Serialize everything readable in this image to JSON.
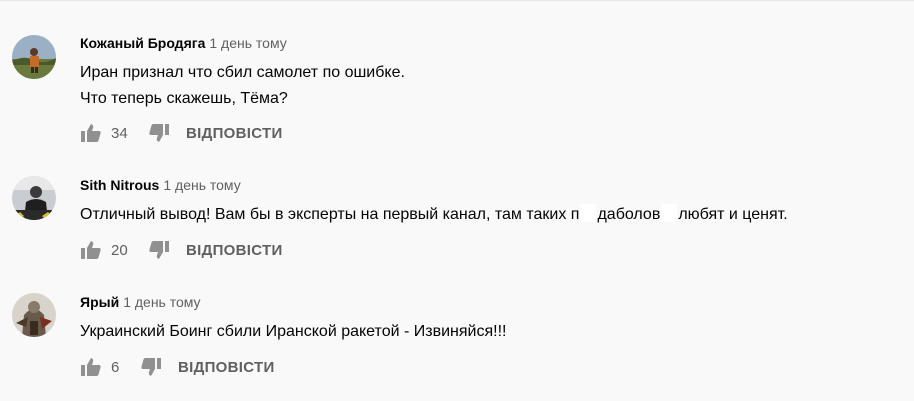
{
  "comments": [
    {
      "author": "Кожаный Бродяга",
      "time": "1 день тому",
      "lines": [
        "Иран признал что сбил самолет по ошибке.",
        "Что теперь скажешь, Тёма?"
      ],
      "likes": "34",
      "reply": "ВІДПОВІСТИ"
    },
    {
      "author": "Sith Nitrous",
      "time": "1 день тому",
      "text_a": "Отличный вывод! Вам бы в эксперты на первый канал, там таких п",
      "text_b": "даболов",
      "text_c": "любят и ценят.",
      "likes": "20",
      "reply": "ВІДПОВІСТИ"
    },
    {
      "author": "Ярый",
      "time": "1 день тому",
      "lines": [
        "Украинский Боинг сбили Иранской ракетой - Извиняйся!!!"
      ],
      "likes": "6",
      "reply": "ВІДПОВІСТИ"
    }
  ],
  "icons": {
    "like": "thumb-up-icon",
    "dislike": "thumb-down-icon"
  },
  "colors": {
    "background": "#f9f9f9",
    "text": "#030303",
    "secondary": "#606060"
  }
}
